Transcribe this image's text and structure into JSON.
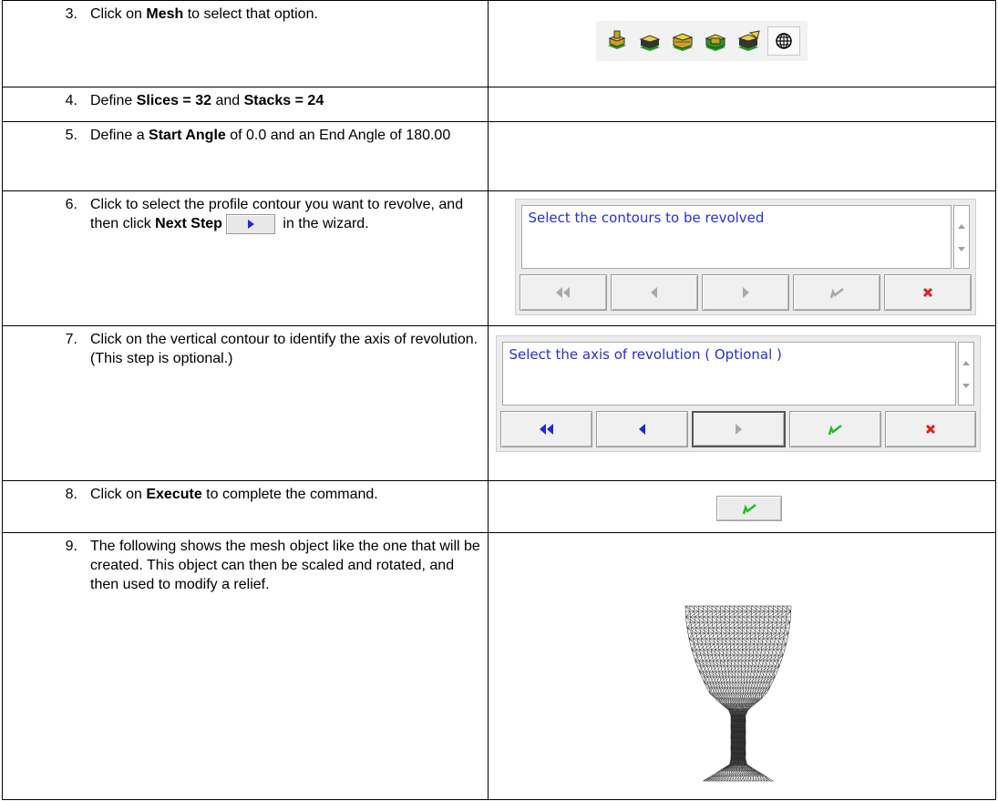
{
  "rows": [
    {
      "num": "3.",
      "parts": [
        {
          "t": "Click on "
        },
        {
          "b": "Mesh"
        },
        {
          "t": " to select that option."
        }
      ]
    },
    {
      "num": "4.",
      "parts": [
        {
          "t": "Define "
        },
        {
          "b": "Slices = 32"
        },
        {
          "t": " and "
        },
        {
          "b": "Stacks = 24"
        }
      ]
    },
    {
      "num": "5.",
      "parts": [
        {
          "t": "Define a "
        },
        {
          "b": "Start Angle"
        },
        {
          "t": " of 0.0 and an End Angle of 180.00"
        }
      ]
    },
    {
      "num": "6.",
      "parts": [
        {
          "t": "Click to select the profile contour you want to revolve, and then click "
        },
        {
          "b": "Next Step"
        },
        {
          "t": " in the wizard."
        }
      ]
    },
    {
      "num": "7.",
      "parts": [
        {
          "t": "Click on the vertical contour to identify the axis of revolution.  (This step is optional.)"
        }
      ]
    },
    {
      "num": "8.",
      "parts": [
        {
          "t": "Click on "
        },
        {
          "b": "Execute"
        },
        {
          "t": " to complete the command."
        }
      ]
    },
    {
      "num": "9.",
      "parts": [
        {
          "t": "The following shows the mesh object like the one that will be created.  This object can then be scaled and rotated, and then used to modify a relief."
        }
      ]
    }
  ],
  "toolbar": {
    "icons": [
      "extrude-icon",
      "spin-icon",
      "sweep-icon",
      "revolve-icon",
      "offset-icon",
      "mesh-icon"
    ]
  },
  "wizard1": {
    "prompt": "Select the contours to be revolved"
  },
  "wizard2": {
    "prompt": "Select the axis of revolution ( Optional )"
  },
  "colors": {
    "prompt_text": "#2431d8",
    "active_nav": "#1a2bd6",
    "execute_green": "#1fc21f",
    "cancel_red": "#e01f1f"
  }
}
